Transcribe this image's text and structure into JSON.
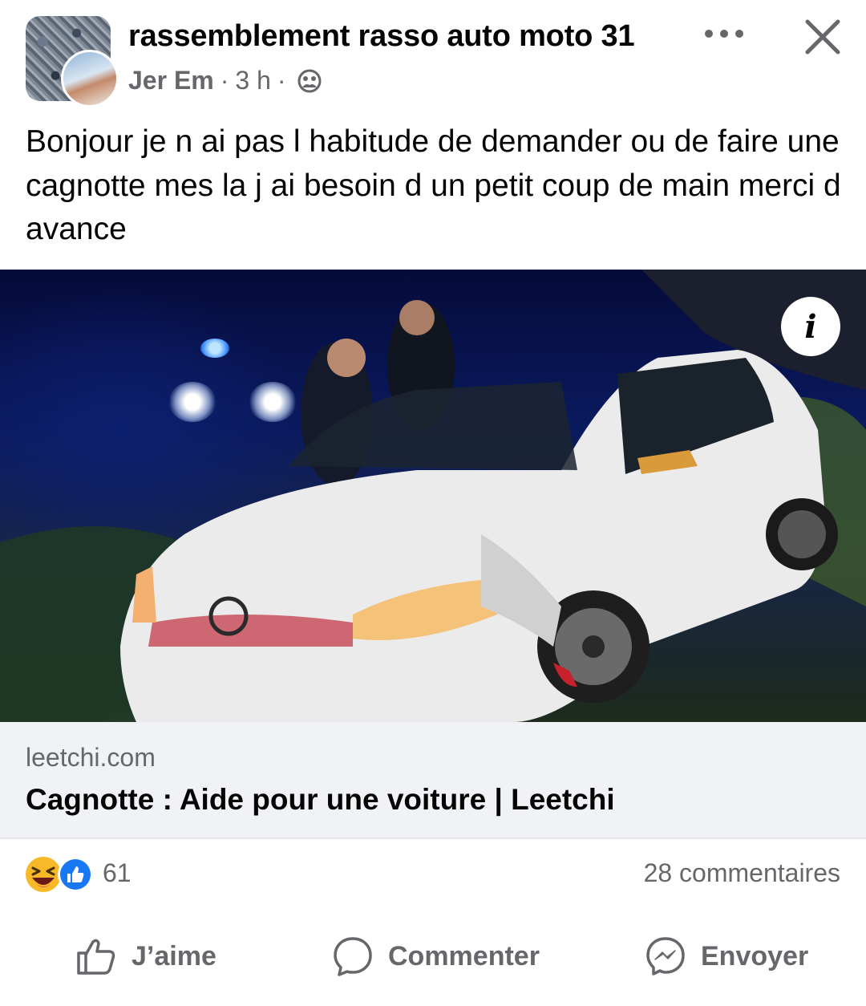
{
  "post": {
    "group_name": "rassemblement rasso auto moto 31",
    "author": "Jer Em",
    "time": "3 h",
    "text": "Bonjour je n ai pas l habitude de demander ou de faire une cagnotte mes la j ai besoin d un petit coup de main merci d avance"
  },
  "link": {
    "domain": "leetchi.com",
    "title": "Cagnotte : Aide pour une voiture | Leetchi"
  },
  "engagement": {
    "reaction_count": "61",
    "comments": "28 commentaires"
  },
  "actions": {
    "like": "J’aime",
    "comment": "Commenter",
    "send": "Envoyer"
  },
  "image": {
    "info_glyph": "i"
  },
  "colors": {
    "secondary_text": "#65676b",
    "card_bg": "#f0f2f5",
    "like_blue": "#1877f2",
    "haha_yellow": "#f7b928"
  }
}
